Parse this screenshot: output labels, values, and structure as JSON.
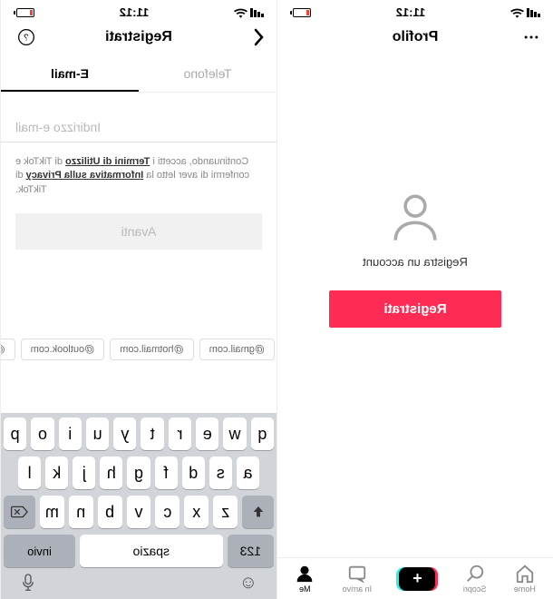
{
  "status": {
    "time": "11:12"
  },
  "left": {
    "nav_title": "Profilo",
    "empty_label": "Registra un account",
    "register_label": "Registrati",
    "bottom_nav": {
      "home": "Home",
      "discover": "Scopri",
      "inbox": "In arrivo",
      "me": "Me"
    }
  },
  "right": {
    "nav_title": "Registrati",
    "tab_phone": "Telefono",
    "tab_email": "E-mail",
    "email_placeholder": "Indirizzo e-mail",
    "disclaimer": {
      "p1": "Continuando, accetti i ",
      "terms": "Termini di Utilizzo",
      "p2": " di TikTok e confermi di aver letto la ",
      "privacy": "Informativa sulla Privacy",
      "p3": " di TikTok."
    },
    "next_label": "Avanti",
    "suggestions": [
      "@gmail.com",
      "@hotmail.com",
      "@outlook.com",
      "@ya"
    ],
    "keyboard": {
      "row1": [
        "q",
        "w",
        "e",
        "r",
        "t",
        "y",
        "u",
        "i",
        "o",
        "p"
      ],
      "row2": [
        "a",
        "s",
        "d",
        "f",
        "g",
        "h",
        "j",
        "k",
        "l"
      ],
      "row3": [
        "z",
        "x",
        "c",
        "v",
        "b",
        "n",
        "m"
      ],
      "numKey": "123",
      "space": "spazio",
      "enter": "invio"
    }
  }
}
